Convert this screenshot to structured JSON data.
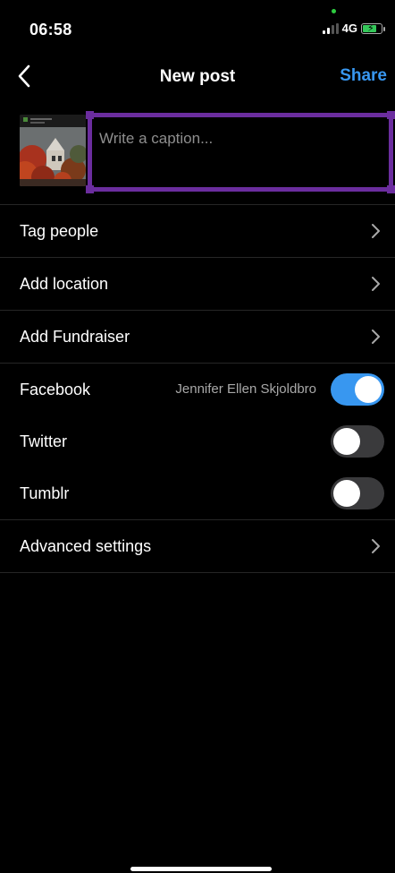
{
  "status_bar": {
    "time": "06:58",
    "network": "4G"
  },
  "nav": {
    "title": "New post",
    "share_label": "Share",
    "back_icon": "chevron-left-icon",
    "accent_color": "#3897f0"
  },
  "compose": {
    "caption_placeholder": "Write a caption...",
    "caption_value": "",
    "highlight_color": "#6b2d9e"
  },
  "menu": {
    "tag_people": "Tag people",
    "add_location": "Add location",
    "add_fundraiser": "Add Fundraiser",
    "advanced_settings": "Advanced settings"
  },
  "share_to": [
    {
      "label": "Facebook",
      "account": "Jennifer Ellen Skjoldbro",
      "enabled": true
    },
    {
      "label": "Twitter",
      "account": "",
      "enabled": false
    },
    {
      "label": "Tumblr",
      "account": "",
      "enabled": false
    }
  ]
}
